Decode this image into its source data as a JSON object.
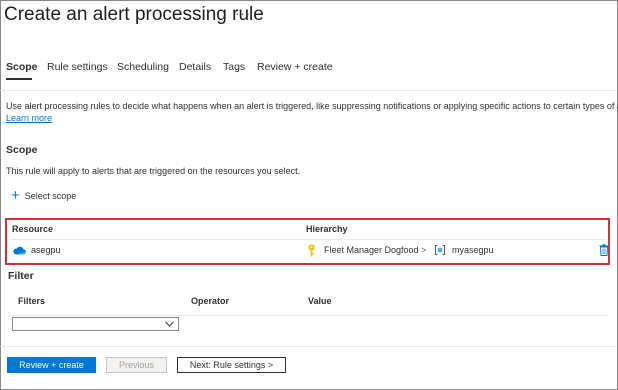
{
  "header": {
    "title": "Create an alert processing rule",
    "more": "···"
  },
  "tabs": [
    {
      "label": "Scope"
    },
    {
      "label": "Rule settings"
    },
    {
      "label": "Scheduling"
    },
    {
      "label": "Details"
    },
    {
      "label": "Tags"
    },
    {
      "label": "Review + create"
    }
  ],
  "intro": {
    "text": "Use alert processing rules to decide what happens when an alert is triggered, like suppressing notifications or applying specific actions to certain types of alerts.",
    "link": "Learn more"
  },
  "scope": {
    "heading": "Scope",
    "description": "This rule will apply to alerts that are triggered on the resources you select.",
    "select_scope": "Select scope",
    "columns": {
      "resource": "Resource",
      "hierarchy": "Hierarchy"
    },
    "rows": [
      {
        "resource": "asegpu",
        "hierarchy_1": "Fleet Manager Dogfood",
        "separator": ">",
        "hierarchy_2": "myasegpu"
      }
    ]
  },
  "filter": {
    "heading": "Filter",
    "columns": {
      "filters": "Filters",
      "operator": "Operator",
      "value": "Value"
    },
    "dropdown_value": ""
  },
  "footer": {
    "review_create": "Review + create",
    "previous": "Previous",
    "next": "Next: Rule settings >"
  },
  "icons": {
    "cloud": "cloud-icon",
    "key": "key-icon",
    "resource": "resource-icon",
    "delete": "delete-icon",
    "chevron": "chevron-down-icon",
    "plus": "plus-icon"
  },
  "colors": {
    "accent": "#0078d4",
    "highlight": "#d13438",
    "key": "#f2c811"
  }
}
